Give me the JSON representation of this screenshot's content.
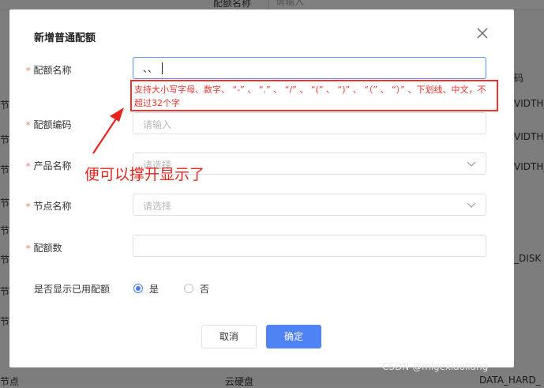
{
  "background": {
    "header_col_quota_name": "配额名称",
    "header_search_placeholder": "请输入",
    "left_cells": [
      "节",
      "节",
      "节",
      "节",
      "节",
      "节",
      "节",
      "节",
      "节点"
    ],
    "right_cells": [
      "码",
      "VIDTH_",
      "VIDTH_",
      "VIDTH_",
      "_DISK"
    ],
    "bottom_mid": "云硬盘",
    "bottom_right": "DATA_HARD_"
  },
  "dialog": {
    "title": "新增普通配额",
    "close_icon": "close-icon",
    "fields": {
      "quota_name": {
        "label": "配额名称",
        "required_mark": "*",
        "value": "、、"
      },
      "quota_code": {
        "label": "配额编码",
        "required_mark": "*",
        "placeholder": "请输入"
      },
      "product_name": {
        "label": "产品名称",
        "required_mark": "*",
        "placeholder": "请选择"
      },
      "node_name": {
        "label": "节点名称",
        "required_mark": "*",
        "placeholder": "请选择"
      },
      "quota_count": {
        "label": "配额数",
        "required_mark": "*",
        "value": ""
      }
    },
    "validation_message": "支持大小写字母、数字、 “-” 、 “.” 、 “/” 、 “(” 、 “)” 、 “（” 、 “）” 、下划线、中文，不超过32个字",
    "show_used": {
      "label": "是否显示已用配额",
      "options": [
        "是",
        "否"
      ],
      "selected": "是"
    },
    "buttons": {
      "cancel": "取消",
      "confirm": "确定"
    }
  },
  "annotation": {
    "text": "便可以撑开显示了",
    "color": "#e3271f"
  },
  "watermark": "CSDN @migexiaoliang",
  "colors": {
    "primary": "#4e82f5",
    "error": "#f0322d",
    "overlay": "#7d7d7d"
  }
}
